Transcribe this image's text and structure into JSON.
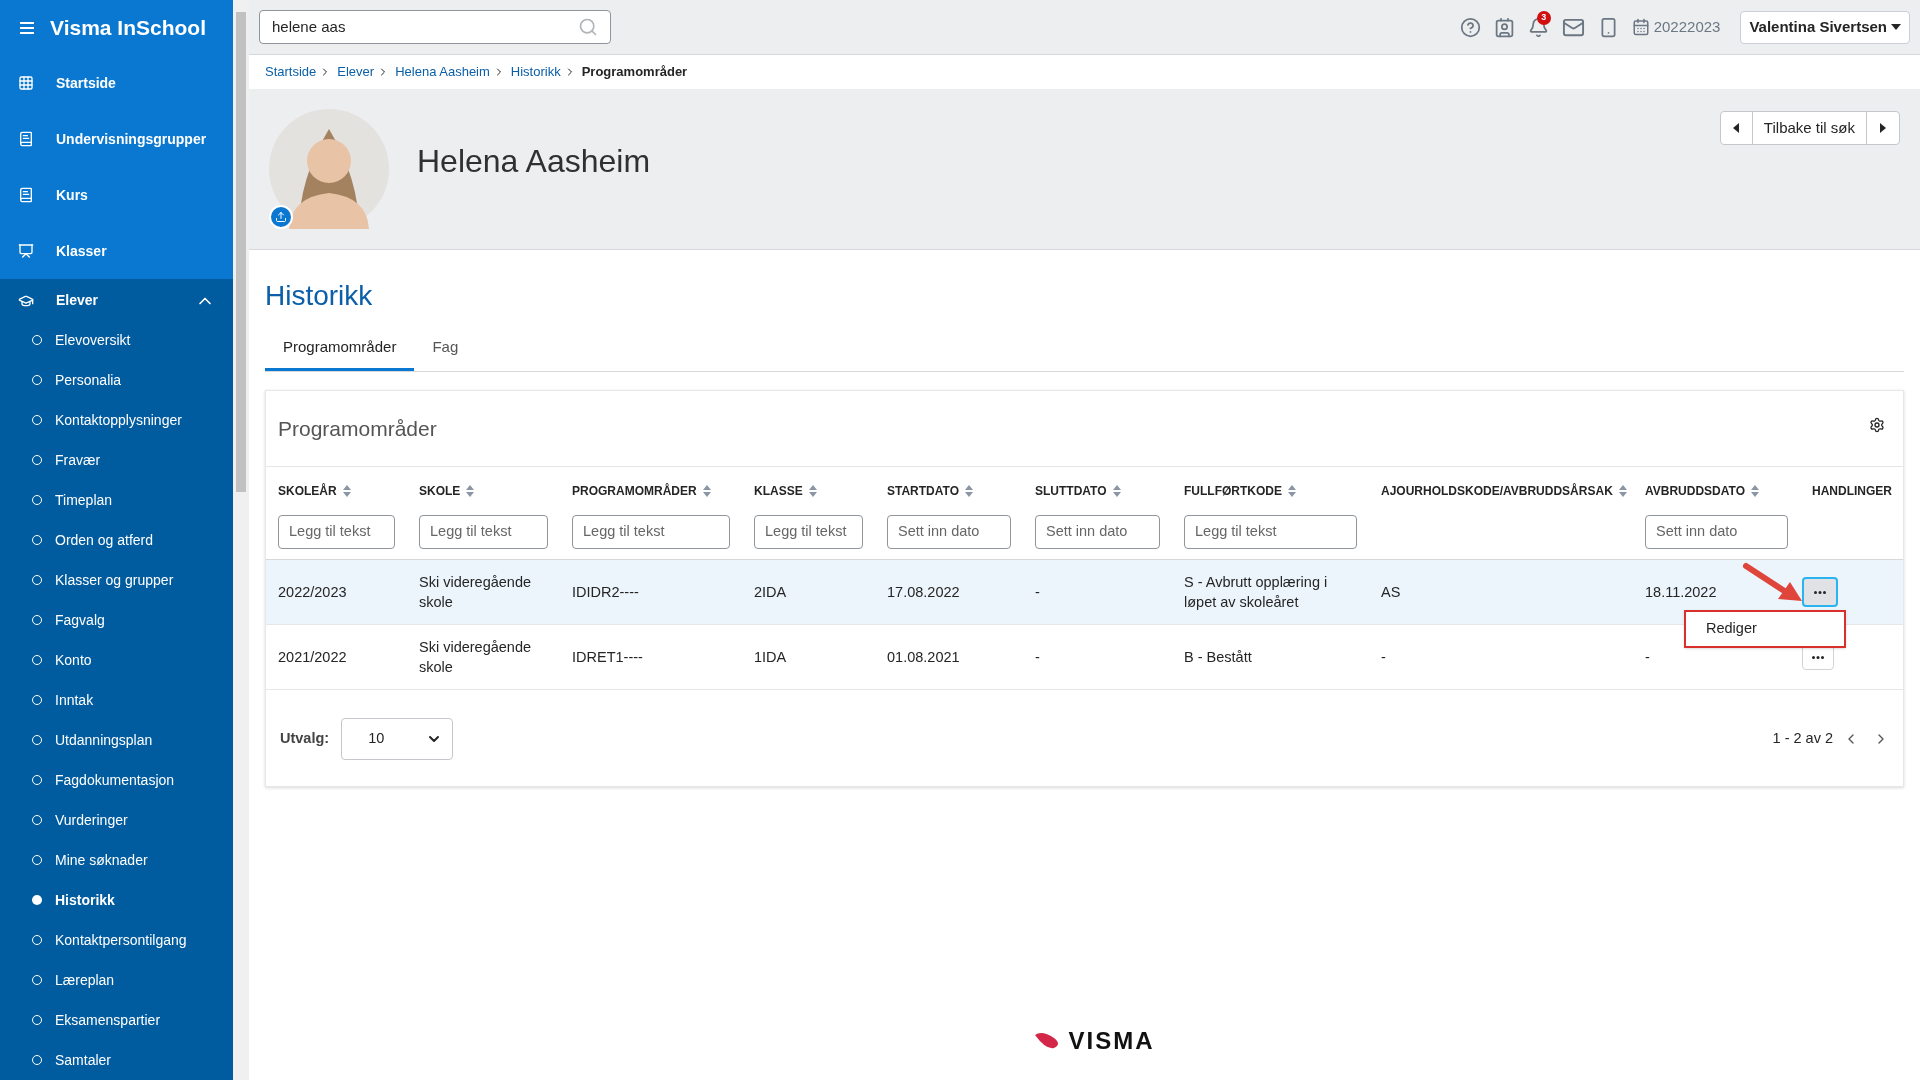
{
  "app": {
    "title": "Visma InSchool"
  },
  "sidebar": {
    "items": [
      {
        "label": "Startside",
        "kind": "grid"
      },
      {
        "label": "Undervisningsgrupper",
        "kind": "book"
      },
      {
        "label": "Kurs",
        "kind": "book"
      },
      {
        "label": "Klasser",
        "kind": "board"
      }
    ],
    "section": {
      "label": "Elever",
      "expanded": true,
      "children": [
        {
          "label": "Elevoversikt",
          "selected": false
        },
        {
          "label": "Personalia",
          "selected": false
        },
        {
          "label": "Kontaktopplysninger",
          "selected": false
        },
        {
          "label": "Fravær",
          "selected": false
        },
        {
          "label": "Timeplan",
          "selected": false
        },
        {
          "label": "Orden og atferd",
          "selected": false
        },
        {
          "label": "Klasser og grupper",
          "selected": false
        },
        {
          "label": "Fagvalg",
          "selected": false
        },
        {
          "label": "Konto",
          "selected": false
        },
        {
          "label": "Inntak",
          "selected": false
        },
        {
          "label": "Utdanningsplan",
          "selected": false
        },
        {
          "label": "Fagdokumentasjon",
          "selected": false
        },
        {
          "label": "Vurderinger",
          "selected": false
        },
        {
          "label": "Mine søknader",
          "selected": false
        },
        {
          "label": "Historikk",
          "selected": true
        },
        {
          "label": "Kontaktpersontilgang",
          "selected": false
        },
        {
          "label": "Læreplan",
          "selected": false
        },
        {
          "label": "Eksamenspartier",
          "selected": false
        },
        {
          "label": "Samtaler",
          "selected": false
        }
      ]
    }
  },
  "topbar": {
    "search": {
      "value": "helene aas"
    },
    "notification_count": "3",
    "school_year": "20222023",
    "user": "Valentina Sivertsen"
  },
  "breadcrumb": [
    {
      "label": "Startside",
      "current": false
    },
    {
      "label": "Elever",
      "current": false
    },
    {
      "label": "Helena Aasheim",
      "current": false
    },
    {
      "label": "Historikk",
      "current": false
    },
    {
      "label": "Programområder",
      "current": true
    }
  ],
  "student": {
    "name": "Helena Aasheim"
  },
  "back_button": "Tilbake til søk",
  "page_title": "Historikk",
  "tabs": [
    {
      "label": "Programområder",
      "selected": true
    },
    {
      "label": "Fag",
      "selected": false
    }
  ],
  "card": {
    "title": "Programområder",
    "columns": [
      {
        "label": "SKOLEÅR",
        "sortable": true,
        "filter": "Legg til tekst"
      },
      {
        "label": "SKOLE",
        "sortable": true,
        "filter": "Legg til tekst"
      },
      {
        "label": "PROGRAMOMRÅDER",
        "sortable": true,
        "filter": "Legg til tekst"
      },
      {
        "label": "KLASSE",
        "sortable": true,
        "filter": "Legg til tekst"
      },
      {
        "label": "STARTDATO",
        "sortable": true,
        "filter": "Sett inn dato"
      },
      {
        "label": "SLUTTDATO",
        "sortable": true,
        "filter": "Sett inn dato"
      },
      {
        "label": "FULLFØRTKODE",
        "sortable": true,
        "filter": "Legg til tekst"
      },
      {
        "label": "AJOURHOLDSKODE/AVBRUDDSÅRSAK",
        "sortable": true
      },
      {
        "label": "AVBRUDDSDATO",
        "sortable": true,
        "filter": "Sett inn dato"
      },
      {
        "label": "HANDLINGER",
        "sortable": false
      }
    ],
    "rows": [
      {
        "cells": [
          "2022/2023",
          "Ski videregående skole",
          "IDIDR2----",
          "2IDA",
          "17.08.2022",
          "-",
          "S - Avbrutt opplæring i løpet av skoleåret",
          "AS",
          "18.11.2022"
        ],
        "selected": true,
        "menu_open": true,
        "menu": [
          "Rediger"
        ]
      },
      {
        "cells": [
          "2021/2022",
          "Ski videregående skole",
          "IDRET1----",
          "1IDA",
          "01.08.2021",
          "-",
          "B - Bestått",
          "-",
          "-"
        ],
        "selected": false,
        "menu_open": false
      }
    ],
    "page_size_label": "Utvalg:",
    "page_size": "10",
    "pagination": "1 - 2 av 2"
  },
  "footer": {
    "logo": "VISMA"
  }
}
